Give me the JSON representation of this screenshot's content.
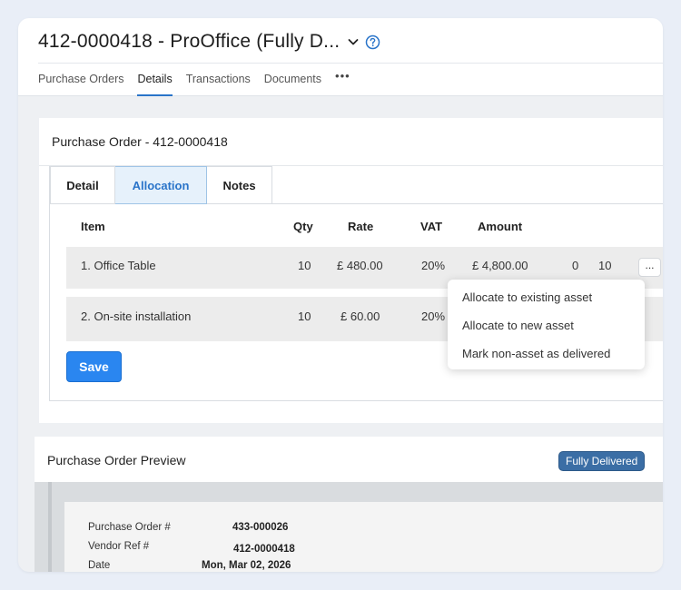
{
  "header": {
    "title": "412-0000418 - ProOffice (Fully D...",
    "tabs": [
      "Purchase Orders",
      "Details",
      "Transactions",
      "Documents"
    ],
    "active_tab": "Details",
    "more_label": "•••"
  },
  "po_card": {
    "title": "Purchase Order - 412-0000418",
    "inner_tabs": [
      "Detail",
      "Allocation",
      "Notes"
    ],
    "active_inner_tab": "Allocation",
    "columns": [
      "Item",
      "Qty",
      "Rate",
      "VAT",
      "Amount"
    ],
    "rows": [
      {
        "item": "1. Office Table",
        "qty": "10",
        "rate": "£ 480.00",
        "vat": "20%",
        "amount": "£ 4,800.00",
        "extra1": "0",
        "extra2": "10"
      },
      {
        "item": "2. On-site installation",
        "qty": "10",
        "rate": "£ 60.00",
        "vat": "20%"
      }
    ],
    "row_more_label": "...",
    "save_label": "Save"
  },
  "dropdown": {
    "items": [
      "Allocate to existing asset",
      "Allocate to new asset",
      "Mark non-asset as delivered"
    ]
  },
  "preview": {
    "title": "Purchase Order Preview",
    "status_badge": "Fully Delivered",
    "fields": [
      {
        "label": "Purchase Order #",
        "value": "433-000026"
      },
      {
        "label": "Vendor Ref #",
        "value": "412-0000418"
      },
      {
        "label": "Date",
        "value": "Mon, Mar 02, 2026"
      }
    ]
  },
  "colors": {
    "accent": "#2a74c9",
    "save_button": "#2a86f0",
    "badge": "#3b6ea5"
  }
}
